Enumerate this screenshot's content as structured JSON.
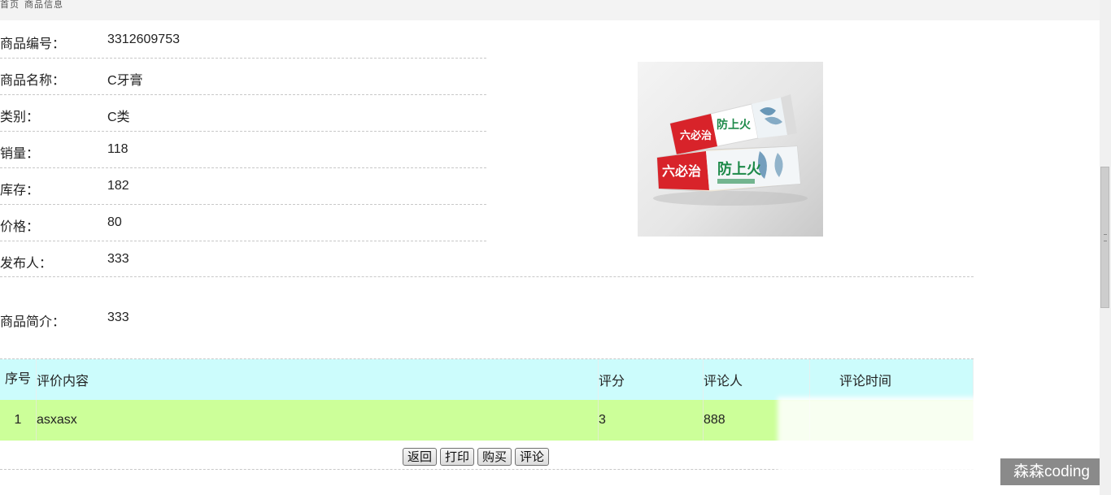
{
  "breadcrumb": [
    "首页",
    "商品信息"
  ],
  "product": {
    "fields": [
      {
        "label": "商品编号：",
        "value": "3312609753"
      },
      {
        "label": "商品名称：",
        "value": "C牙膏"
      },
      {
        "label": "类别：",
        "value": "C类"
      },
      {
        "label": "销量：",
        "value": "118"
      },
      {
        "label": "库存：",
        "value": "182"
      },
      {
        "label": "价格：",
        "value": "80"
      },
      {
        "label": "发布人：",
        "value": "333"
      }
    ],
    "description_label": "商品简介：",
    "description": "333",
    "image": {
      "brand_text": "六必治",
      "tube_text": "防上火",
      "box_text": "防上火"
    }
  },
  "reviews": {
    "headers": [
      "序号",
      "评价内容",
      "评分",
      "评论人",
      "评论时间"
    ],
    "rows": [
      {
        "no": "1",
        "content": "asxasx",
        "score": "3",
        "reviewer": "888"
      }
    ]
  },
  "buttons": {
    "back": "返回",
    "print": "打印",
    "buy": "购买",
    "comment": "评论"
  },
  "watermark": "森森coding",
  "colors": {
    "table_header_bg": "#ccfcfc",
    "table_row_bg": "#ccff99",
    "brand_red": "#d8232a",
    "brand_green": "#1e8a4a"
  }
}
